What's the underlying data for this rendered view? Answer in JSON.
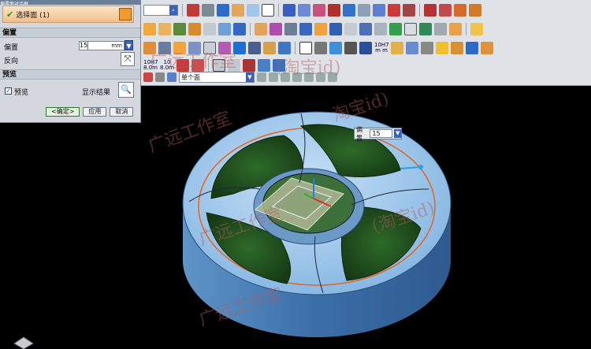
{
  "dialog": {
    "title": "偏置面对话框",
    "selection_label": "选择面 (1)",
    "group_offset": "偏置",
    "offset_label": "偏置",
    "offset_value": "15",
    "offset_unit": "mm",
    "reverse_label": "反向",
    "group_preview": "预览",
    "preview_label": "预览",
    "preview_checked": true,
    "show_result_label": "显示结果",
    "ok_label": "<确定>",
    "apply_label": "应用",
    "cancel_label": "取消"
  },
  "toolbar": {
    "view_filter_value": "单个面",
    "tags": [
      "10H7 m m",
      "10H7 8.0m",
      "10 8.0m"
    ]
  },
  "floating": {
    "label": "偏置",
    "value": "15"
  },
  "watermarks": [
    "广远工作室",
    "(淘宝id)",
    "广远工作室",
    "淘宝id)",
    "广远工作室",
    "(淘宝id)",
    "广远工作室"
  ],
  "colors": {
    "accent_orange": "#f29a2e",
    "model_blue": "#7fb2e0",
    "blade_green": "#1f4d1c",
    "circle_orange": "#e5651f"
  }
}
